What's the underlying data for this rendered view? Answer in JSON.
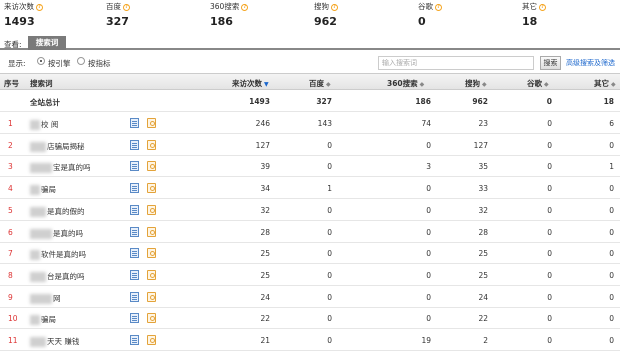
{
  "summary": [
    {
      "label": "来访次数",
      "value": "1493"
    },
    {
      "label": "百度",
      "value": "327"
    },
    {
      "label": "360搜索",
      "value": "186"
    },
    {
      "label": "搜狗",
      "value": "962"
    },
    {
      "label": "谷歌",
      "value": "0"
    },
    {
      "label": "其它",
      "value": "18"
    }
  ],
  "view": {
    "label": "查看:",
    "tab": "搜索词"
  },
  "filter": {
    "label": "显示:",
    "option1": "按引擎",
    "option2": "按指标",
    "selected": "按引擎",
    "search_placeholder": "输入搜索词",
    "search_button": "搜索",
    "advanced_link": "高级搜索及筛选"
  },
  "table": {
    "headers": {
      "index": "序号",
      "keyword": "搜索词",
      "visits": "来访次数",
      "baidu": "百度",
      "s360": "360搜索",
      "sogou": "搜狗",
      "google": "谷歌",
      "other": "其它"
    },
    "total": {
      "keyword": "全站总计",
      "visits": "1493",
      "baidu": "327",
      "s360": "186",
      "sogou": "962",
      "google": "0",
      "other": "18"
    },
    "rows": [
      {
        "index": "1",
        "keyword": "校 阅",
        "visits": "246",
        "baidu": "143",
        "s360": "74",
        "sogou": "23",
        "google": "0",
        "other": "6"
      },
      {
        "index": "2",
        "keyword": "店骗局揭秘",
        "visits": "127",
        "baidu": "0",
        "s360": "0",
        "sogou": "127",
        "google": "0",
        "other": "0"
      },
      {
        "index": "3",
        "keyword": "宝是真的吗",
        "visits": "39",
        "baidu": "0",
        "s360": "3",
        "sogou": "35",
        "google": "0",
        "other": "1"
      },
      {
        "index": "4",
        "keyword": "骗局",
        "visits": "34",
        "baidu": "1",
        "s360": "0",
        "sogou": "33",
        "google": "0",
        "other": "0"
      },
      {
        "index": "5",
        "keyword": "是真的假的",
        "visits": "32",
        "baidu": "0",
        "s360": "0",
        "sogou": "32",
        "google": "0",
        "other": "0"
      },
      {
        "index": "6",
        "keyword": "是真的吗",
        "visits": "28",
        "baidu": "0",
        "s360": "0",
        "sogou": "28",
        "google": "0",
        "other": "0"
      },
      {
        "index": "7",
        "keyword": "软件是真的吗",
        "visits": "25",
        "baidu": "0",
        "s360": "0",
        "sogou": "25",
        "google": "0",
        "other": "0"
      },
      {
        "index": "8",
        "keyword": "台是真的吗",
        "visits": "25",
        "baidu": "0",
        "s360": "0",
        "sogou": "25",
        "google": "0",
        "other": "0"
      },
      {
        "index": "9",
        "keyword": "网",
        "visits": "24",
        "baidu": "0",
        "s360": "0",
        "sogou": "24",
        "google": "0",
        "other": "0"
      },
      {
        "index": "10",
        "keyword": "骗局",
        "visits": "22",
        "baidu": "0",
        "s360": "0",
        "sogou": "22",
        "google": "0",
        "other": "0"
      },
      {
        "index": "11",
        "keyword": "天天 赚钱",
        "visits": "21",
        "baidu": "0",
        "s360": "19",
        "sogou": "2",
        "google": "0",
        "other": "0"
      }
    ]
  }
}
